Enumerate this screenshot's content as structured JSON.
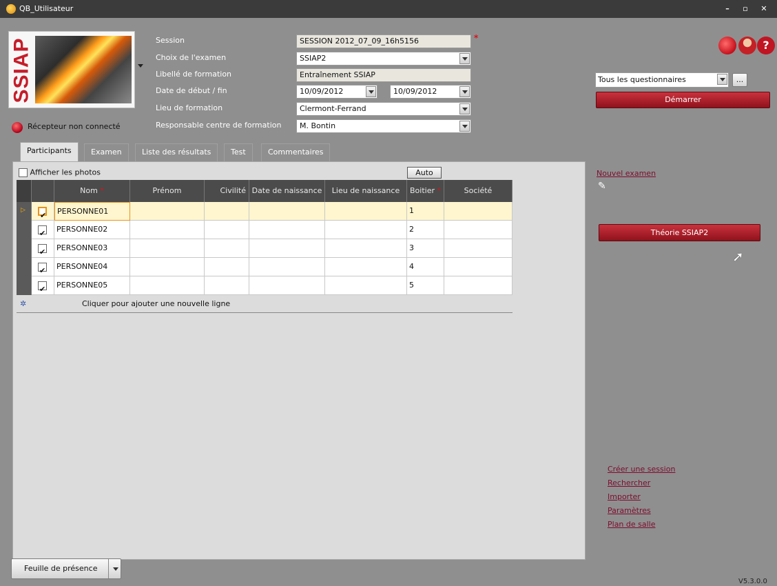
{
  "window": {
    "title": "QB_Utilisateur",
    "minimize": "–",
    "maximize": "▫",
    "close": "✕"
  },
  "logo": {
    "text": "SSIAP"
  },
  "form": {
    "session": {
      "label": "Session",
      "value": "SESSION 2012_07_09_16h5156",
      "required_mark": "*"
    },
    "exam_choice": {
      "label": "Choix de l'examen",
      "value": "SSIAP2"
    },
    "training_label": {
      "label": "Libellé de formation",
      "value": "Entraînement SSIAP"
    },
    "dates": {
      "label": "Date de début / fin",
      "start": "10/09/2012",
      "end": "10/09/2012"
    },
    "location": {
      "label": "Lieu de formation",
      "value": "Clermont-Ferrand"
    },
    "manager": {
      "label": "Responsable centre de formation",
      "value": "M. Bontin"
    }
  },
  "status": {
    "text": "Récepteur non connecté",
    "color": "#c0001a"
  },
  "tabs": [
    "Participants",
    "Examen",
    "Liste des résultats",
    "Test",
    "Commentaires"
  ],
  "panel": {
    "show_photos": "Afficher les photos",
    "auto_button": "Auto",
    "columns": {
      "nom": "Nom",
      "prenom": "Prénom",
      "civilite": "Civilité",
      "date_naissance": "Date de naissance",
      "lieu_naissance": "Lieu de naissance",
      "boitier": "Boitier",
      "societe": "Société"
    },
    "rows": [
      {
        "nom": "PERSONNE01",
        "boitier": "1"
      },
      {
        "nom": "PERSONNE02",
        "boitier": "2"
      },
      {
        "nom": "PERSONNE03",
        "boitier": "3"
      },
      {
        "nom": "PERSONNE04",
        "boitier": "4"
      },
      {
        "nom": "PERSONNE05",
        "boitier": "5"
      }
    ],
    "add_row": "Cliquer pour ajouter une nouvelle ligne"
  },
  "right": {
    "questionnaire": "Tous les questionnaires",
    "ellipsis": "...",
    "start": "Démarrer",
    "new_exam": "Nouvel examen",
    "theory": "Théorie SSIAP2",
    "links": {
      "create_session": "Créer une session",
      "search": "Rechercher",
      "import": "Importer",
      "settings": "Paramètres",
      "room_plan": "Plan de salle"
    }
  },
  "bottom": {
    "attendance": "Feuille de présence",
    "version": "V5.3.0.0"
  },
  "colors": {
    "accent_red": "#b2202b",
    "link": "#7d0c2e",
    "header": "#4b4b4b"
  }
}
